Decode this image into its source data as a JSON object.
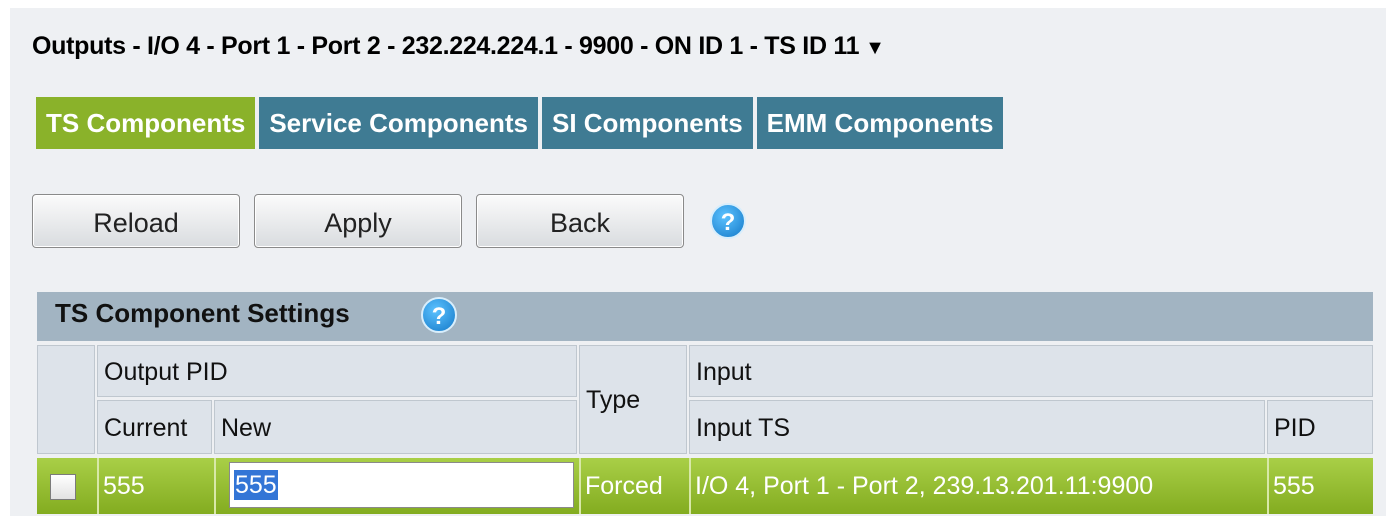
{
  "header": {
    "title": "Outputs - I/O 4 - Port 1 - Port 2 - 232.224.224.1 - 9900 - ON ID 1 - TS ID 11",
    "dropdown_arrow": "▼"
  },
  "tabs": [
    {
      "label": "TS Components",
      "active": true
    },
    {
      "label": "Service Components",
      "active": false
    },
    {
      "label": "SI Components",
      "active": false
    },
    {
      "label": "EMM Components",
      "active": false
    }
  ],
  "toolbar": {
    "reload_label": "Reload",
    "apply_label": "Apply",
    "back_label": "Back",
    "help_glyph": "?"
  },
  "settings": {
    "title": "TS Component Settings",
    "help_glyph": "?",
    "columns": {
      "output_pid": "Output PID",
      "current": "Current",
      "new": "New",
      "type": "Type",
      "input": "Input",
      "input_ts": "Input TS",
      "pid": "PID"
    },
    "rows": [
      {
        "checked": false,
        "current": "555",
        "new": "555",
        "type": "Forced",
        "input_ts": "I/O 4, Port 1 - Port 2, 239.13.201.11:9900",
        "pid": "555"
      }
    ]
  },
  "colors": {
    "active_tab": "#8ab22a",
    "inactive_tab": "#3f7b93",
    "row_green": "#94bd33",
    "header_bar": "#a2b4c2"
  }
}
